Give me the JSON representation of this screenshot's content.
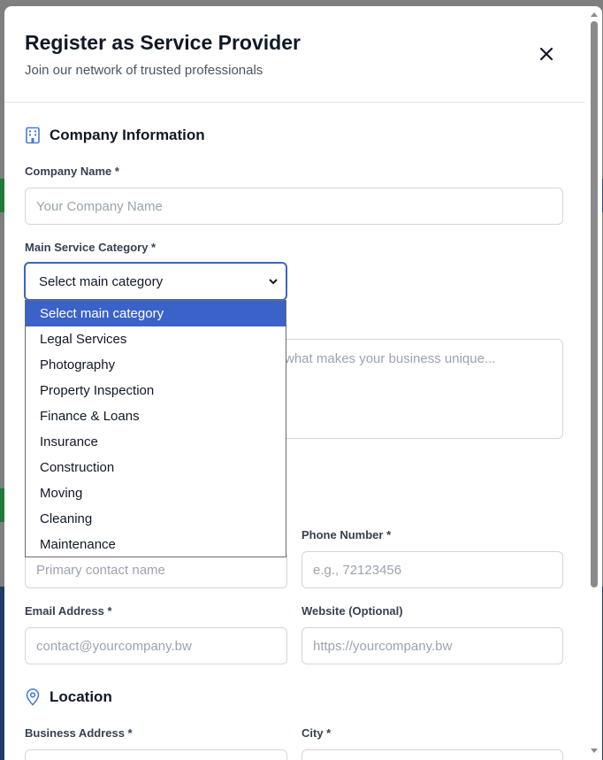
{
  "modal": {
    "title": "Register as Service Provider",
    "subtitle": "Join our network of trusted professionals",
    "close_icon": "close-icon"
  },
  "company_section": {
    "icon": "building-icon",
    "title": "Company Information",
    "company_name_label": "Company Name *",
    "company_name_placeholder": "Your Company Name",
    "category_label": "Main Service Category *",
    "category_selected": "Select main category",
    "description_placeholder_visible": "what makes your business unique...",
    "category_options": [
      "Select main category",
      "Legal Services",
      "Photography",
      "Property Inspection",
      "Finance & Loans",
      "Insurance",
      "Construction",
      "Moving",
      "Cleaning",
      "Maintenance"
    ]
  },
  "contact": {
    "contact_name_placeholder": "Primary contact name",
    "phone_label": "Phone Number *",
    "phone_placeholder": "e.g., 72123456",
    "email_label": "Email Address *",
    "email_placeholder": "contact@yourcompany.bw",
    "website_label": "Website (Optional)",
    "website_placeholder": "https://yourcompany.bw"
  },
  "location_section": {
    "icon": "map-pin-icon",
    "title": "Location",
    "address_label": "Business Address *",
    "city_label": "City *"
  },
  "colors": {
    "accent": "#3a62c9",
    "icon_blue": "#4a7bd8"
  }
}
